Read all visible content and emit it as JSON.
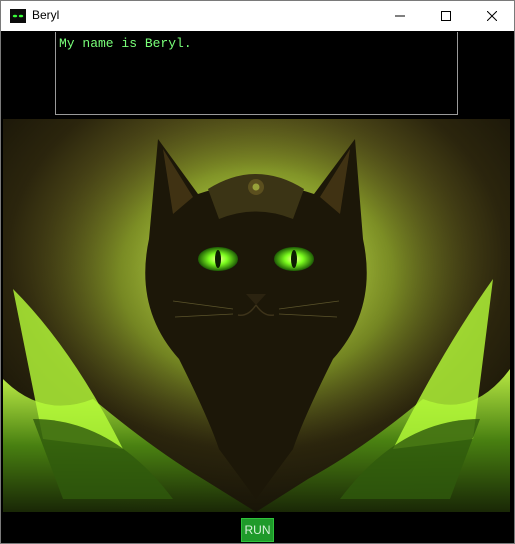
{
  "window": {
    "title": "Beryl"
  },
  "titlebar": {
    "app_icon": "cat-eyes-icon",
    "minimize_icon": "minimize-icon",
    "maximize_icon": "maximize-icon",
    "close_icon": "close-icon"
  },
  "console": {
    "text": "My name is Beryl."
  },
  "art": {
    "description_icon": "cat-portrait-image"
  },
  "controls": {
    "run_label": "RUN"
  },
  "colors": {
    "console_text": "#79ff79",
    "run_button": "#1f9a2a",
    "eye_glow": "#7dff1f"
  }
}
